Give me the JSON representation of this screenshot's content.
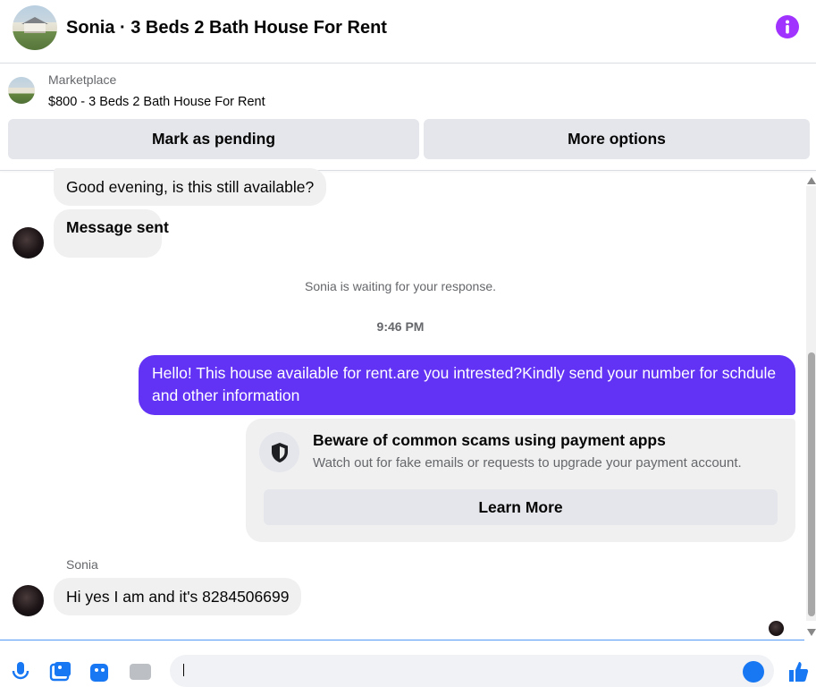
{
  "header": {
    "title": "Sonia · 3 Beds 2 Bath House For Rent",
    "icons": {
      "avatar": "house-photo",
      "info": "info-icon"
    },
    "accent_color": "#a033ff"
  },
  "marketplace": {
    "label": "Marketplace",
    "item": "$800 - 3 Beds 2 Bath House For Rent",
    "buttons": {
      "pending": "Mark as pending",
      "more": "More options"
    }
  },
  "messages": [
    {
      "from": "Sonia",
      "text": "Good evening, is this still available?"
    },
    {
      "from": "Sonia",
      "text": "Message sent"
    }
  ],
  "status": {
    "waiting": "Sonia is waiting for your response.",
    "timestamp": "9:46 PM"
  },
  "outgoing": {
    "text": "Hello! This house available for rent.are you intrested?Kindly send your number for schdule and other information",
    "color": "#6232f5"
  },
  "scam_notice": {
    "icon": "shield-icon",
    "title": "Beware of common scams using payment apps",
    "description": "Watch out for fake emails or requests to upgrade your payment account.",
    "button": "Learn More"
  },
  "reply": {
    "sender": "Sonia",
    "text": "Hi yes I am and it's 8284506699"
  },
  "composer": {
    "icons": [
      "microphone-icon",
      "photo-icon",
      "sticker-icon",
      "gif-icon",
      "emoji-icon",
      "like-icon"
    ]
  }
}
